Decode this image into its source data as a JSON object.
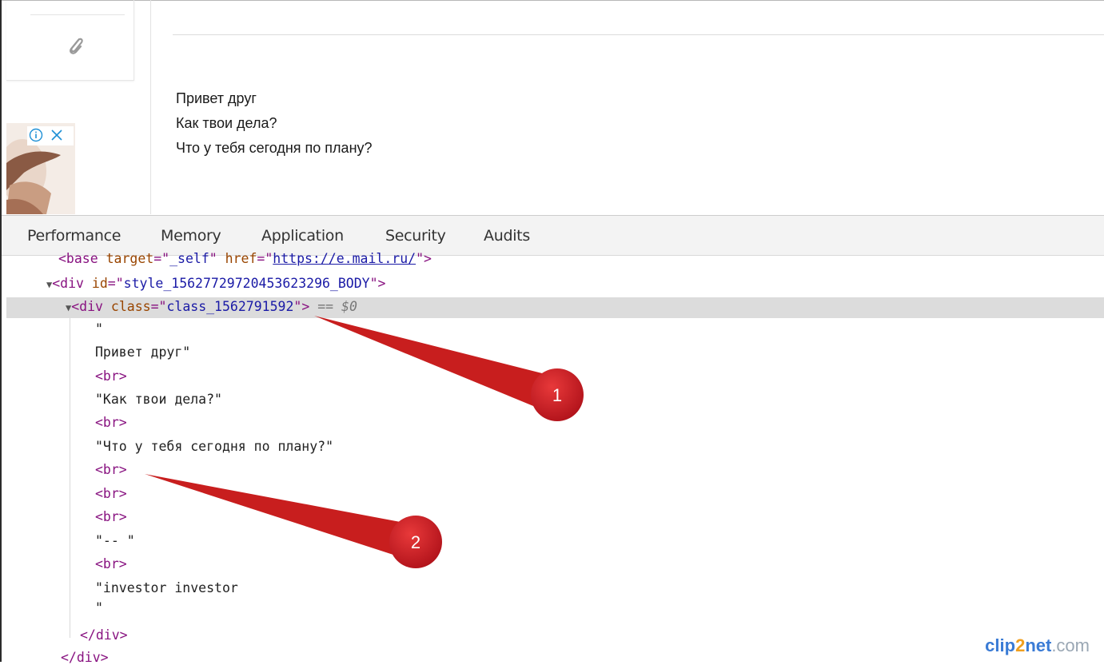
{
  "email": {
    "lines": [
      "Привет друг",
      "Как твои дела?",
      "Что у тебя сегодня по плану?"
    ]
  },
  "icons": {
    "attachment": "paperclip-icon",
    "ad_info": "info-icon",
    "ad_close": "close-icon"
  },
  "devtools": {
    "tabs": [
      "Performance",
      "Memory",
      "Application",
      "Security",
      "Audits"
    ],
    "elements": {
      "base_line": {
        "open": "<base ",
        "a1": "target",
        "eq": "=\"",
        "v1": "_self",
        "q": "\" ",
        "a2": "href",
        "v2": "https://e.mail.ru/",
        "close": ">"
      },
      "div_body": {
        "open": "<div ",
        "attr": "id",
        "val": "style_15627729720453623296_BODY",
        "close": ">"
      },
      "div_class": {
        "open": "<div ",
        "attr": "class",
        "val": "class_1562791592",
        "close": ">",
        "marker": " == $0"
      },
      "children": [
        "\"",
        "Привет друг\"",
        "<br>",
        "\"Как твои дела?\"",
        "<br>",
        "\"Что у тебя сегодня по плану?\"",
        "<br>",
        "<br>",
        "<br>",
        "\"-- \"",
        "<br>",
        "\"investor investor",
        "\""
      ],
      "close_inner": "</div>",
      "close_outer": "</div>"
    }
  },
  "annotations": [
    {
      "label": "1"
    },
    {
      "label": "2"
    }
  ],
  "watermark": {
    "part1": "clip",
    "part2": "2",
    "part3": "net",
    "part4": ".com"
  },
  "colors": {
    "arrow": "#c81e1e",
    "tag": "#881280",
    "attr": "#994500",
    "value": "#1a1aa6"
  }
}
